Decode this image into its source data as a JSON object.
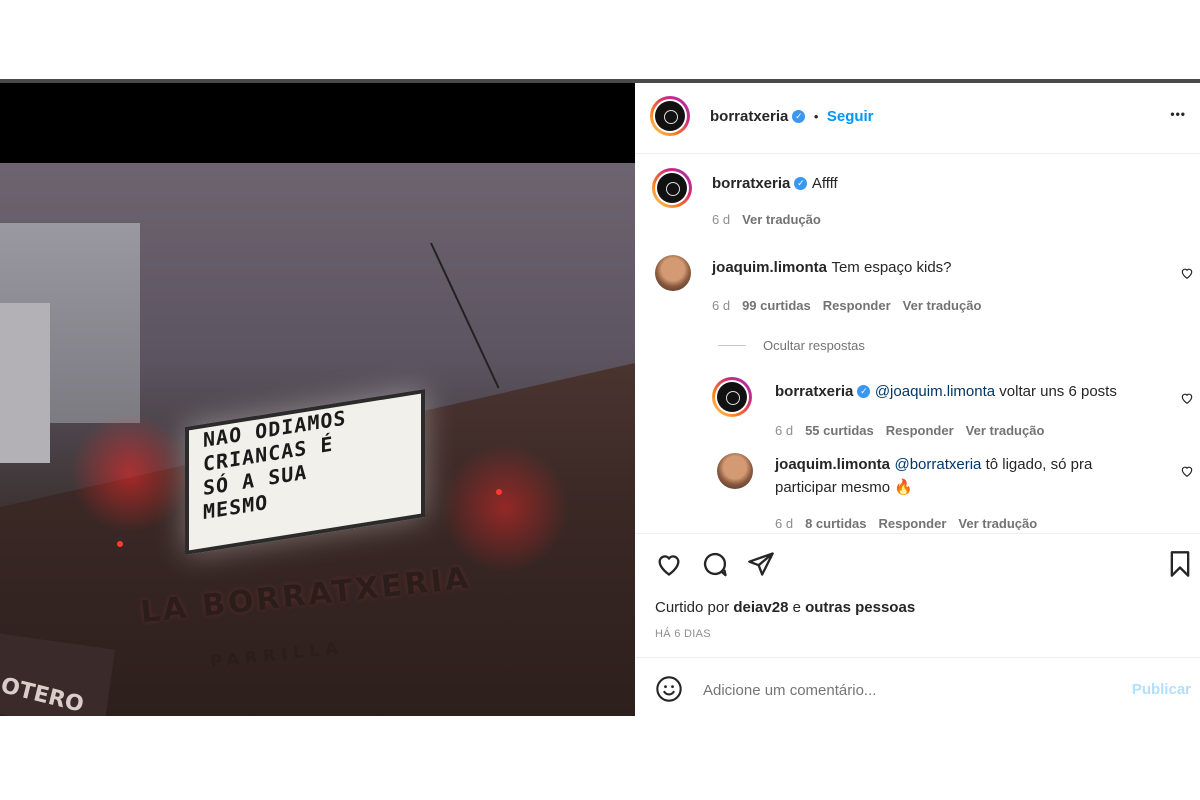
{
  "post": {
    "sign_lines": [
      "NAO ODIAMOS",
      "CRIANCAS  É",
      "SÓ A SUA",
      "  MESMO"
    ],
    "venue_name": "LA BORRATXERIA",
    "venue_sub": "PARRILLA",
    "awning_text": "OTERO"
  },
  "header": {
    "username": "borratxeria",
    "separator": "•",
    "follow_label": "Seguir",
    "more_label": "•••"
  },
  "caption": {
    "username": "borratxeria",
    "text": "Affff",
    "time": "6 d",
    "translate": "Ver tradução"
  },
  "comments": [
    {
      "username": "joaquim.limonta",
      "text": "Tem espaço kids?",
      "time": "6 d",
      "likes": "99 curtidas",
      "reply": "Responder",
      "translate": "Ver tradução"
    }
  ],
  "replies_toggle": "Ocultar respostas",
  "replies": [
    {
      "username": "borratxeria",
      "mention": "@joaquim.limonta",
      "text": " voltar uns 6 posts",
      "time": "6 d",
      "likes": "55 curtidas",
      "reply": "Responder",
      "translate": "Ver tradução"
    },
    {
      "username": "joaquim.limonta",
      "mention": "@borratxeria",
      "text": " tô ligado, só pra",
      "text2": "participar mesmo 🔥",
      "time": "6 d",
      "likes": "8 curtidas",
      "reply": "Responder",
      "translate": "Ver tradução"
    }
  ],
  "likes_line": {
    "prefix": "Curtido por ",
    "user": "deiav28",
    "mid": " e ",
    "others": "outras pessoas"
  },
  "date": "HÁ 6 DIAS",
  "composer": {
    "placeholder": "Adicione um comentário...",
    "publish": "Publicar"
  },
  "icons": [
    "heart-icon",
    "comment-icon",
    "share-icon",
    "bookmark-icon",
    "emoji-icon",
    "more-icon",
    "verified-icon"
  ],
  "colors": {
    "accent": "#0095f6",
    "publish_disabled": "#b2dffc",
    "verified": "#3897f0"
  }
}
